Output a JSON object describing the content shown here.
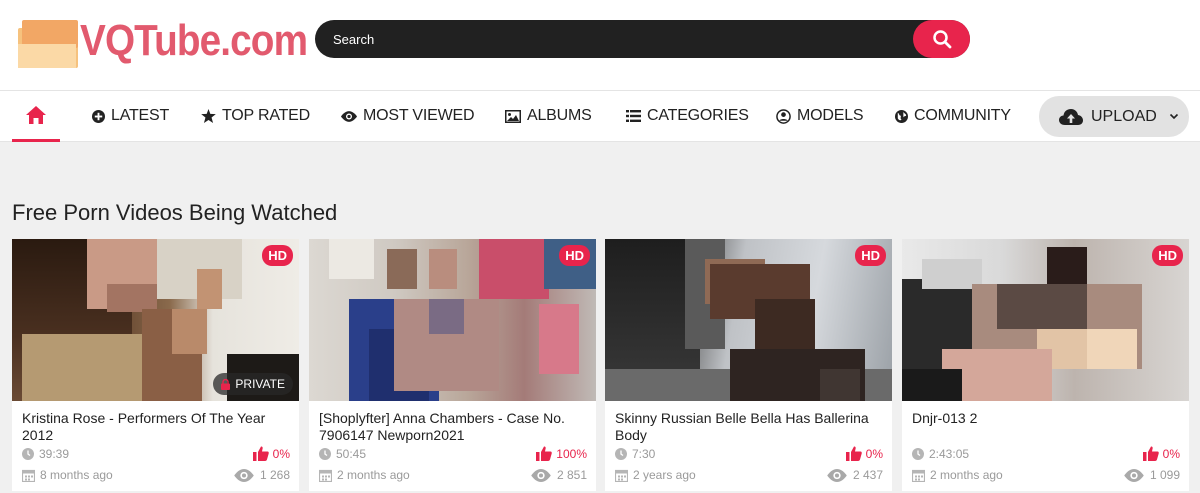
{
  "logo": {
    "text": "VQTube.com"
  },
  "search": {
    "placeholder": "Search"
  },
  "nav": {
    "items": [
      {
        "label": "LATEST"
      },
      {
        "label": "TOP RATED"
      },
      {
        "label": "MOST VIEWED"
      },
      {
        "label": "ALBUMS"
      },
      {
        "label": "CATEGORIES"
      },
      {
        "label": "MODELS"
      },
      {
        "label": "COMMUNITY"
      }
    ],
    "upload": "UPLOAD"
  },
  "section": {
    "title": "Free Porn Videos Being Watched"
  },
  "colors": {
    "accent": "#e8244c",
    "logo": "#e25a6e",
    "search_bg": "#212121"
  },
  "videos": [
    {
      "title": "Kristina Rose - Performers Of The Year 2012",
      "duration": "39:39",
      "age": "8 months ago",
      "rating": "0%",
      "views": "1 268",
      "hd": "HD",
      "private": "PRIVATE"
    },
    {
      "title": "[Shoplyfter] Anna Chambers - Case No. 7906147 Newporn2021",
      "duration": "50:45",
      "age": "2 months ago",
      "rating": "100%",
      "views": "2 851",
      "hd": "HD"
    },
    {
      "title": "Skinny Russian Belle Bella Has Ballerina Body",
      "duration": "7:30",
      "age": "2 years ago",
      "rating": "0%",
      "views": "2 437",
      "hd": "HD"
    },
    {
      "title": "Dnjr-013 2",
      "duration": "2:43:05",
      "age": "2 months ago",
      "rating": "0%",
      "views": "1 099",
      "hd": "HD"
    }
  ]
}
